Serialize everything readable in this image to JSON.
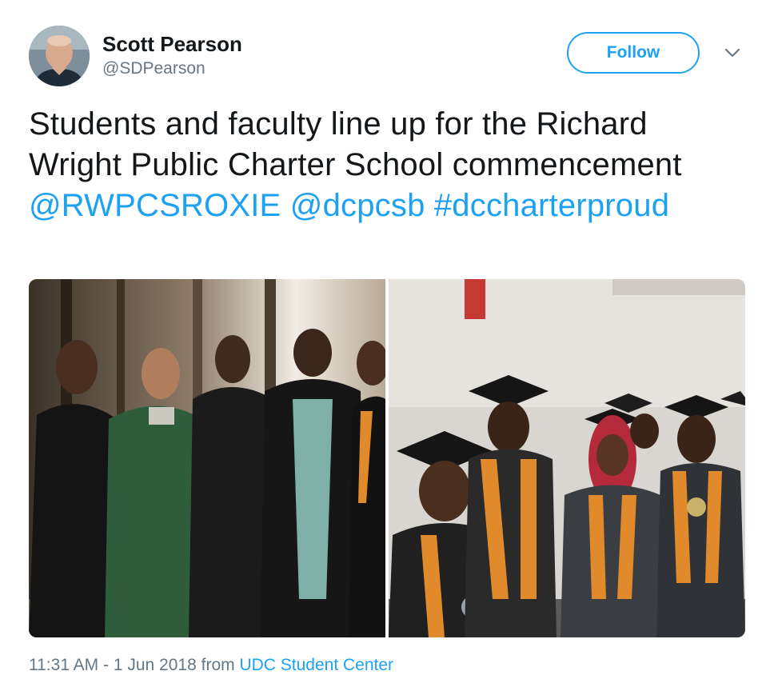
{
  "author": {
    "display_name": "Scott Pearson",
    "handle": "@SDPearson",
    "avatar_icon": "user-avatar-photo"
  },
  "actions": {
    "follow_label": "Follow",
    "menu_icon": "chevron-down-icon"
  },
  "tweet": {
    "text_plain": "Students and faculty line up for the Richard Wright Public Charter School commencement ",
    "mentions": [
      "@RWPCSROXIE",
      "@dcpcsb"
    ],
    "hashtag": "#dccharterproud"
  },
  "media": {
    "photos": [
      {
        "icon": "photo-faculty-group"
      },
      {
        "icon": "photo-graduates-line"
      }
    ]
  },
  "meta": {
    "time": "11:31 AM",
    "separator": " - ",
    "date": "1 Jun 2018",
    "from_label": " from ",
    "source": "UDC Student Center"
  },
  "colors": {
    "link": "#1da1f2",
    "text": "#14171a",
    "muted": "#657786"
  }
}
